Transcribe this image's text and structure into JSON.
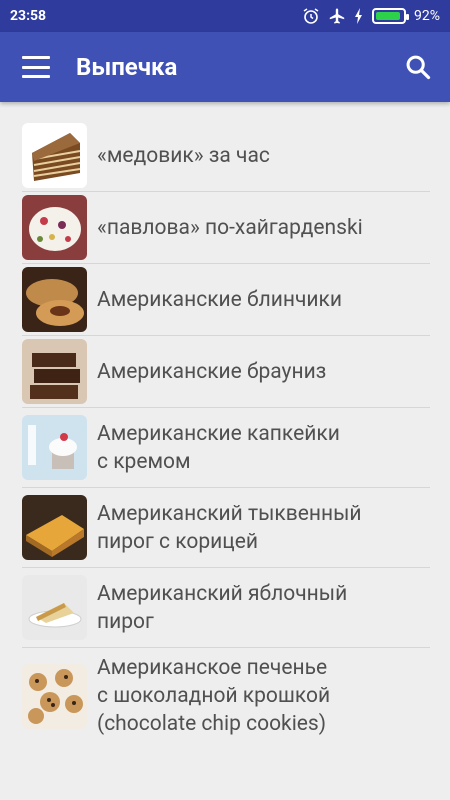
{
  "status_bar": {
    "time": "23:58",
    "battery_percent": "92%",
    "battery_level": 0.92,
    "icons": [
      "alarm-icon",
      "airplane-mode-icon",
      "charging-icon",
      "battery-icon"
    ]
  },
  "app_bar": {
    "title": "Выпечка",
    "menu_icon": "hamburger-menu-icon",
    "search_icon": "search-icon",
    "color": "#3f51b5"
  },
  "recipes": [
    {
      "label": "«медовик» за час",
      "image": "honey-cake-thumbnail"
    },
    {
      "label": "«павлова» по-хайгардenski",
      "image": "pavlova-thumbnail"
    },
    {
      "label": "Американские блинчики",
      "image": "pancakes-thumbnail"
    },
    {
      "label": "Американские брауниз",
      "image": "brownies-thumbnail"
    },
    {
      "label": "Американские капкейки\nс кремом",
      "image": "cupcakes-thumbnail"
    },
    {
      "label": "Американский тыквенный\nпирог с корицей",
      "image": "pumpkin-pie-thumbnail"
    },
    {
      "label": "Американский яблочный\nпирог",
      "image": "apple-pie-thumbnail"
    },
    {
      "label": "Американское печенье\nс шоколадной крошкой\n(chocolate chip cookies)",
      "image": "chocolate-chip-cookies-thumbnail"
    }
  ]
}
